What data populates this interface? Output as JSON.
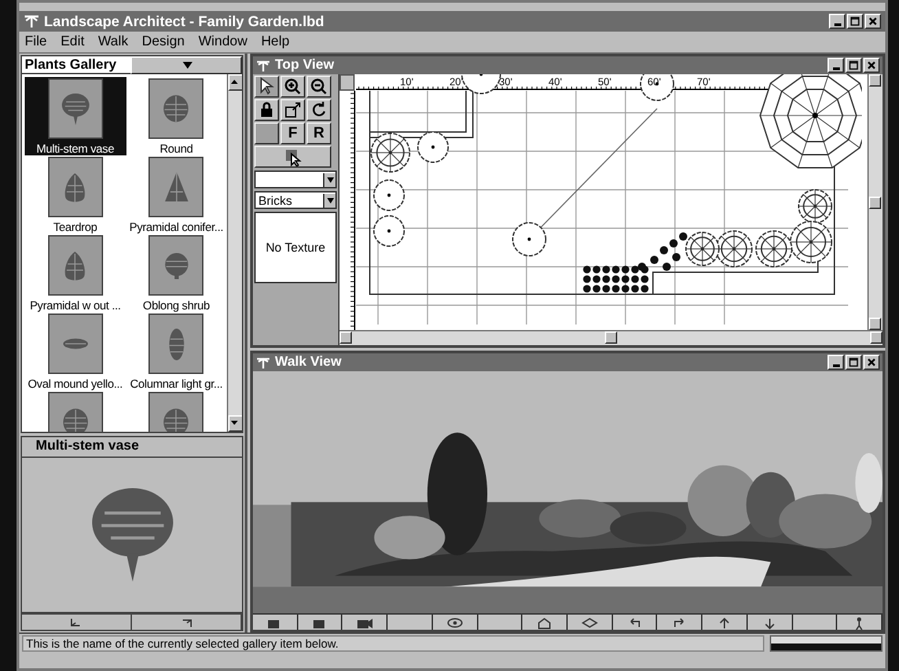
{
  "window": {
    "title": "Landscape Architect - Family Garden.lbd"
  },
  "menu": [
    "File",
    "Edit",
    "Walk",
    "Design",
    "Window",
    "Help"
  ],
  "gallery": {
    "title": "Plants Gallery",
    "items": [
      {
        "label": "Multi-stem vase",
        "kind": "vase",
        "selected": true
      },
      {
        "label": "Round",
        "kind": "round",
        "selected": false
      },
      {
        "label": "Teardrop",
        "kind": "teardrop",
        "selected": false
      },
      {
        "label": "Pyramidal conifer...",
        "kind": "pyramid",
        "selected": false
      },
      {
        "label": "Pyramidal w out ...",
        "kind": "teardrop",
        "selected": false
      },
      {
        "label": "Oblong shrub",
        "kind": "oblong",
        "selected": false
      },
      {
        "label": "Oval mound yello...",
        "kind": "oval",
        "selected": false
      },
      {
        "label": "Columnar light gr...",
        "kind": "columnar",
        "selected": false
      },
      {
        "kind": "round",
        "selected": false
      },
      {
        "kind": "round",
        "selected": false
      }
    ],
    "preview_label": "Multi-stem vase"
  },
  "top_view": {
    "title": "Top View",
    "tools": [
      {
        "kind": "pointer"
      },
      {
        "kind": "zoom-in"
      },
      {
        "kind": "zoom-out"
      },
      {
        "kind": "lock"
      },
      {
        "kind": "resize"
      },
      {
        "kind": "rotate"
      },
      {
        "kind": "blank"
      },
      {
        "kind": "letter",
        "label": "F"
      },
      {
        "kind": "letter",
        "label": "R"
      },
      {
        "kind": "pointer-wide"
      }
    ],
    "material": "Bricks",
    "texture": "No Texture",
    "ruler": [
      "10'",
      "20'",
      "30'",
      "40'",
      "50'",
      "60'",
      "70'"
    ]
  },
  "walk_view": {
    "title": "Walk View"
  },
  "status_bar": "This is the name of the currently selected gallery item below."
}
